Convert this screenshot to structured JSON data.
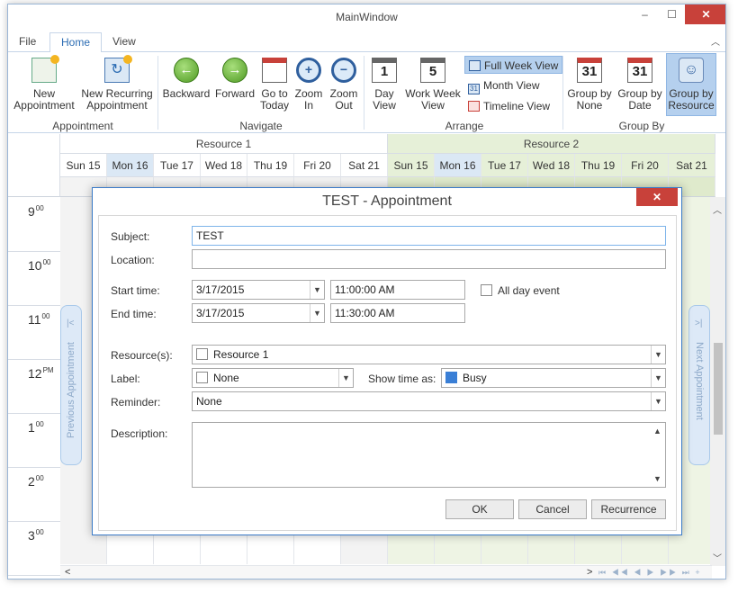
{
  "window": {
    "title": "MainWindow",
    "minimize": "–",
    "maximize": "☐",
    "close": "✕"
  },
  "tabs": {
    "file": "File",
    "home": "Home",
    "view": "View",
    "collapse": "︿"
  },
  "ribbon": {
    "new_appointment": "New Appointment",
    "new_recurring": "New Recurring Appointment",
    "group_appointment": "Appointment",
    "backward": "Backward",
    "forward": "Forward",
    "go_to_today": "Go to Today",
    "zoom_in": "Zoom In",
    "zoom_out": "Zoom Out",
    "group_navigate": "Navigate",
    "day_view": "Day View",
    "work_week_view": "Work Week View",
    "full_week_view": "Full Week View",
    "month_view": "Month View",
    "timeline_view": "Timeline View",
    "group_arrange": "Arrange",
    "group_by_none": "Group by None",
    "group_by_date": "Group by Date",
    "group_by_resource": "Group by Resource",
    "group_group_by": "Group By",
    "day_icon_num": "1",
    "week_icon_num": "5",
    "cal_icon_num": "31"
  },
  "scheduler": {
    "resources": [
      "Resource 1",
      "Resource 2"
    ],
    "days_r1": [
      "Sun 15",
      "Mon 16",
      "Tue 17",
      "Wed 18",
      "Thu 19",
      "Fri 20",
      "Sat 21"
    ],
    "days_r2": [
      "Sun 15",
      "Mon 16",
      "Tue 17",
      "Wed 18",
      "Thu 19",
      "Fri 20",
      "Sat 21"
    ],
    "times": [
      {
        "h": "9",
        "m": "00"
      },
      {
        "h": "10",
        "m": "00"
      },
      {
        "h": "11",
        "m": "00"
      },
      {
        "h": "12",
        "m": "PM"
      },
      {
        "h": "1",
        "m": "00"
      },
      {
        "h": "2",
        "m": "00"
      },
      {
        "h": "3",
        "m": "00"
      }
    ],
    "prev_appointment": "Previous Appointment",
    "next_appointment": "Next Appointment",
    "prev_icon": "|<",
    "next_icon": ">|",
    "scroll_left": "<",
    "scroll_right": ">",
    "nav_glyphs": "⏮ ◀◀ ◀ ▶ ▶▶ ⏭ + −",
    "scroll_up": "︿",
    "scroll_down": "﹀"
  },
  "dialog": {
    "title": "TEST - Appointment",
    "close": "✕",
    "subject_label": "Subject:",
    "subject_value": "TEST",
    "location_label": "Location:",
    "location_value": "",
    "start_time_label": "Start time:",
    "start_date": "3/17/2015",
    "start_time": "11:00:00 AM",
    "all_day_label": "All day event",
    "end_time_label": "End time:",
    "end_date": "3/17/2015",
    "end_time": "11:30:00 AM",
    "resources_label": "Resource(s):",
    "resources_value": "Resource 1",
    "label_label": "Label:",
    "label_value": "None",
    "show_time_as_label": "Show time as:",
    "show_time_as_value": "Busy",
    "reminder_label": "Reminder:",
    "reminder_value": "None",
    "description_label": "Description:",
    "ok": "OK",
    "cancel": "Cancel",
    "recurrence": "Recurrence"
  },
  "colors": {
    "accent": "#2b6cb3",
    "close_red": "#c8413a",
    "resource2_bg": "#e6f0d8",
    "today_col": "#dbe8f5",
    "busy": "#3a7fd6"
  }
}
